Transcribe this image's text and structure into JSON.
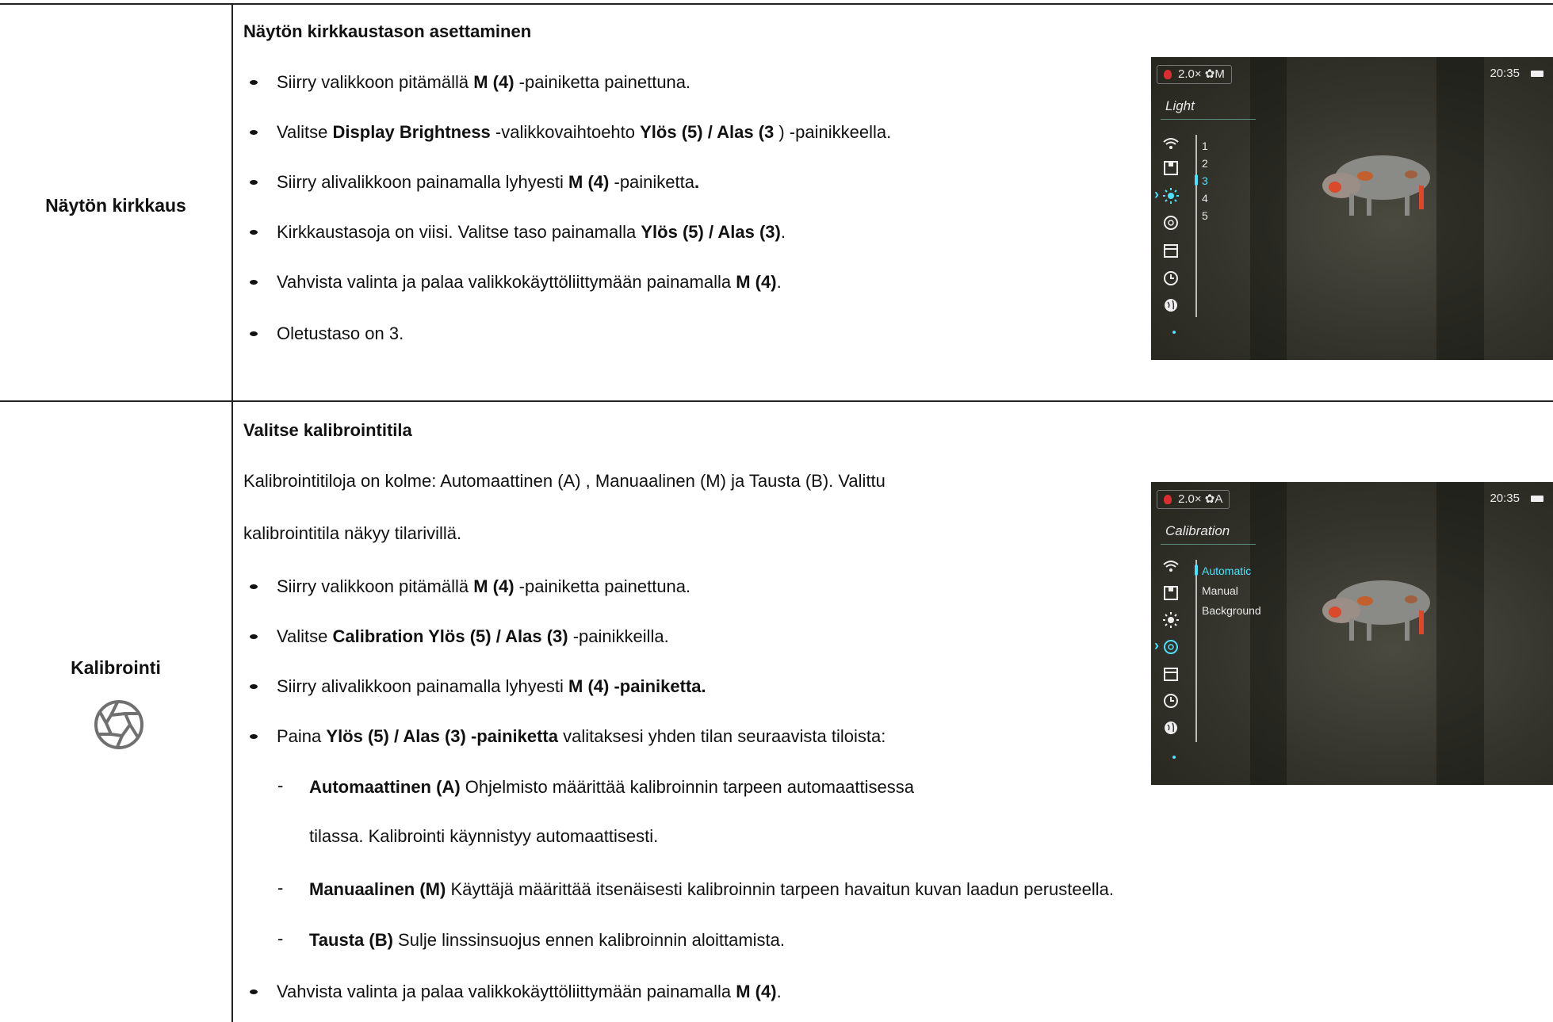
{
  "brightness": {
    "label": "Näytön kirkkaus",
    "heading": "Näytön kirkkaustason asettaminen",
    "b1": {
      "a": "Siirry valikkoon pitämällä ",
      "b": "M (4)",
      "c": " -painiketta painettuna."
    },
    "b2": {
      "a": "Valitse ",
      "b": "Display Brightness",
      "c": " -valikkovaihtoehto ",
      "d": "Ylös (5) / Alas (3",
      "e": " ) -painikkeella."
    },
    "b3": {
      "a": "Siirry alivalikkoon painamalla lyhyesti ",
      "b": "M (4)",
      "c": " -painiketta",
      "d": "."
    },
    "b4": {
      "a": "Kirkkaustasoja on viisi. Valitse taso painamalla ",
      "b": "Ylös (5) / Alas (3)",
      "c": "."
    },
    "b5": {
      "a": "Vahvista valinta ja palaa valikkokäyttöliittymään painamalla ",
      "b": "M (4)",
      "c": "."
    },
    "b6": "Oletustaso on 3.",
    "screen": {
      "zoom": "2.0×",
      "mode": "✿M",
      "time": "20:35",
      "menu_title": "Light",
      "levels": [
        "1",
        "2",
        "3",
        "4",
        "5"
      ],
      "selected_level": "3"
    }
  },
  "calibration": {
    "label": "Kalibrointi",
    "heading": "Valitse kalibrointitila",
    "p1": "Kalibrointitiloja on kolme: Automaattinen (A) , Manuaalinen (M) ja Tausta (B). Valittu",
    "p2": "kalibrointitila näkyy tilarivillä.",
    "b1": {
      "a": "Siirry valikkoon pitämällä ",
      "b": "M (4)",
      "c": " -painiketta painettuna."
    },
    "b2": {
      "a": "Valitse ",
      "b": "Calibration Ylös (5) / Alas (3)",
      "c": " -painikkeilla."
    },
    "b3": {
      "a": "Siirry alivalikkoon painamalla lyhyesti ",
      "b": "M (4) -painiketta."
    },
    "b4": {
      "a": "Paina ",
      "b": "Ylös (5) / Alas (3) -painiketta",
      "c": " valitaksesi yhden tilan seuraavista tiloista:"
    },
    "s1": {
      "dash": "-",
      "b": "Automaattinen (A)",
      "c": " Ohjelmisto määrittää kalibroinnin tarpeen automaattisessa",
      "cont": "tilassa. Kalibrointi käynnistyy automaattisesti."
    },
    "s2": {
      "dash": "-",
      "b": "Manuaalinen (M)",
      "c": " Käyttäjä määrittää itsenäisesti kalibroinnin tarpeen havaitun kuvan laadun perusteella."
    },
    "s3": {
      "dash": "-",
      "b": "Tausta (B)",
      "c": " Sulje linssinsuojus ennen kalibroinnin aloittamista."
    },
    "b5": {
      "a": "Vahvista valinta ja palaa valikkokäyttöliittymään painamalla ",
      "b": "M (4)",
      "c": "."
    },
    "screen": {
      "zoom": "2.0×",
      "mode": "✿A",
      "time": "20:35",
      "menu_title": "Calibration",
      "options": [
        "Automatic",
        "Manual",
        "Background"
      ],
      "selected_option": "Automatic"
    }
  }
}
